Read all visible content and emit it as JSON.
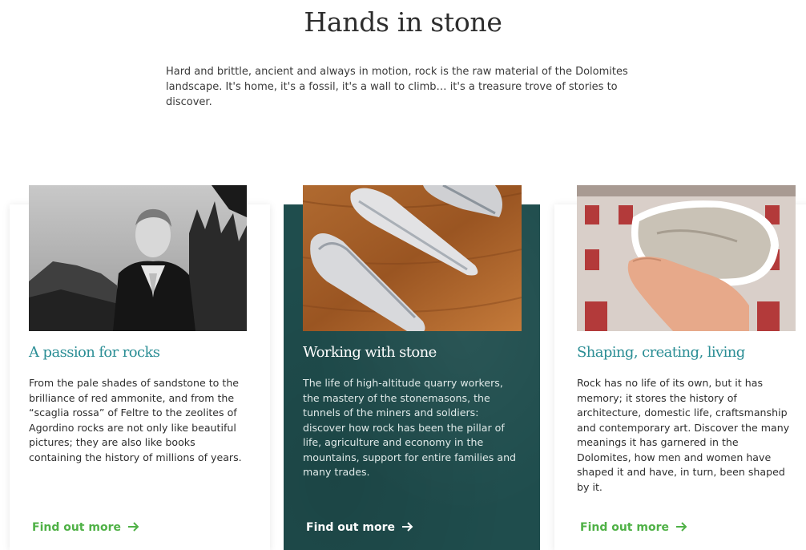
{
  "page": {
    "title": "Hands in stone",
    "intro": "Hard and brittle, ancient and always in motion, rock is the raw material of the Dolomites landscape. It's home, it's a fossil, it's a wall to climb… it's a treasure trove of stories to discover."
  },
  "cards": [
    {
      "title": "A passion for rocks",
      "text": "From the pale shades of sandstone to the brilliance of red ammonite, and from the “scaglia rossa” of Feltre to the zeolites of Agordino rocks are not only like beautiful pictures; they are also like books containing the history of millions of years.",
      "link": "Find out more",
      "image": "portrait-engraving"
    },
    {
      "title": "Working with stone",
      "text": "The life of high-altitude quarry workers, the mastery of the stonemasons, the tunnels of the miners and soldiers: discover how rock has been the pillar of life, agriculture and economy in the mountains, support for entire families and many trades.",
      "link": "Find out more",
      "image": "stone-slabs-on-wood"
    },
    {
      "title": "Shaping, creating, living",
      "text": "Rock has no life of its own, but it has memory; it stores the history of architecture, domestic life, craftsmanship and contemporary art. Discover the many meanings it has garnered in the Dolomites, how men and women have shaped it and have, in turn, been shaped by it.",
      "link": "Find out more",
      "image": "hand-holding-stone"
    }
  ],
  "colors": {
    "title_accent": "#2b8e95",
    "link_green": "#4fb146",
    "featured_card_bg": "#1f4d4d"
  }
}
